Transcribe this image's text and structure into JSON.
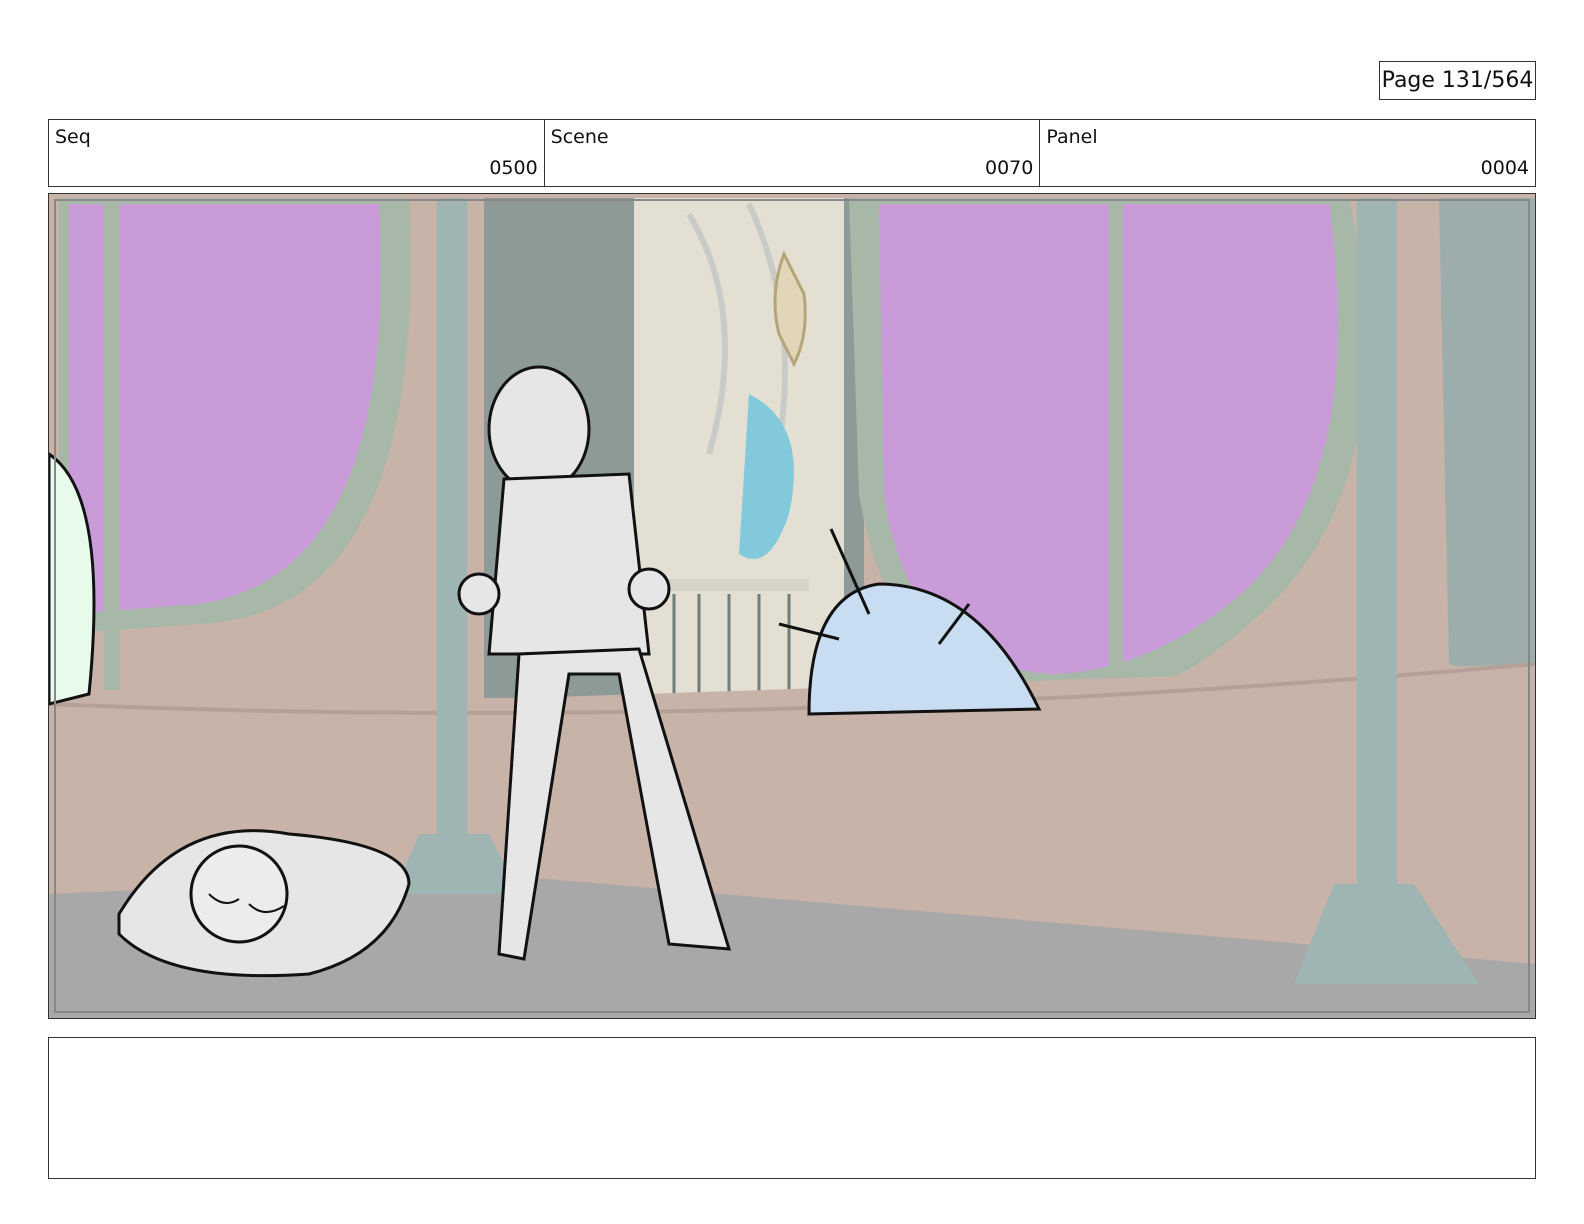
{
  "page": {
    "label": "Page 131/564"
  },
  "header": {
    "seq": {
      "label": "Seq",
      "value": "0500"
    },
    "scene": {
      "label": "Scene",
      "value": "0070"
    },
    "panel": {
      "label": "Panel",
      "value": "0004"
    }
  },
  "artwork": {
    "colors": {
      "window_glass": "#c99bd9",
      "wall": "#c7b3a8",
      "window_frame": "#a7b8a8",
      "pillar": "#9eb5b3",
      "floor": "#a8a8a8",
      "sketch_fill": "#e6e6e6",
      "unicorn_fill": "#c8dcf2",
      "mane": "#82c9dc"
    }
  },
  "notes": {
    "text": ""
  }
}
